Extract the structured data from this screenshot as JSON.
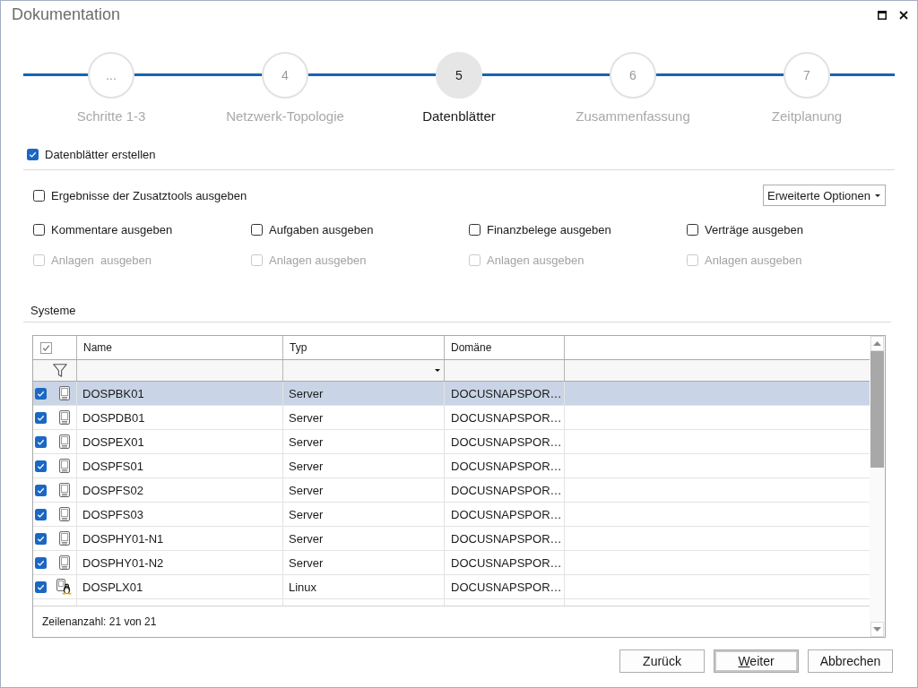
{
  "window": {
    "title": "Dokumentation"
  },
  "steps": [
    {
      "number": "...",
      "label": "Schritte 1-3",
      "selected": false
    },
    {
      "number": "4",
      "label": "Netzwerk-Topologie",
      "selected": false
    },
    {
      "number": "5",
      "label": "Datenblätter",
      "selected": true
    },
    {
      "number": "6",
      "label": "Zusammenfassung",
      "selected": false
    },
    {
      "number": "7",
      "label": "Zeitplanung",
      "selected": false
    }
  ],
  "create_datasheets": {
    "label": "Datenblätter erstellen",
    "checked": true,
    "disabled": false
  },
  "options": {
    "tool_results": {
      "label": "Ergebnisse der Zusatztools ausgeben",
      "checked": false,
      "disabled": false
    },
    "advanced_options": {
      "label": "Erweiterte Optionen"
    },
    "groups": [
      {
        "main": {
          "label": "Kommentare ausgeben",
          "checked": false,
          "disabled": false
        },
        "attachments": {
          "label": "Anlagen  ausgeben",
          "checked": false,
          "disabled": true
        }
      },
      {
        "main": {
          "label": "Aufgaben ausgeben",
          "checked": false,
          "disabled": false
        },
        "attachments": {
          "label": "Anlagen ausgeben",
          "checked": false,
          "disabled": true
        }
      },
      {
        "main": {
          "label": "Finanzbelege ausgeben",
          "checked": false,
          "disabled": false
        },
        "attachments": {
          "label": "Anlagen ausgeben",
          "checked": false,
          "disabled": true
        }
      },
      {
        "main": {
          "label": "Verträge ausgeben",
          "checked": false,
          "disabled": false
        },
        "attachments": {
          "label": "Anlagen ausgeben",
          "checked": false,
          "disabled": true
        }
      }
    ]
  },
  "systems": {
    "title": "Systeme",
    "select_all_checked": true,
    "columns": [
      {
        "label": "Name",
        "kind": "text"
      },
      {
        "label": "Typ",
        "kind": "dropdown"
      },
      {
        "label": "Domäne",
        "kind": "text"
      }
    ],
    "rows": [
      {
        "kind": "server",
        "checked": true,
        "selected": true,
        "cells": [
          "DOSPBK01",
          "Server",
          "DOCUSNAPSPOR…"
        ]
      },
      {
        "kind": "server",
        "checked": true,
        "selected": false,
        "cells": [
          "DOSPDB01",
          "Server",
          "DOCUSNAPSPOR…"
        ]
      },
      {
        "kind": "server",
        "checked": true,
        "selected": false,
        "cells": [
          "DOSPEX01",
          "Server",
          "DOCUSNAPSPOR…"
        ]
      },
      {
        "kind": "server",
        "checked": true,
        "selected": false,
        "cells": [
          "DOSPFS01",
          "Server",
          "DOCUSNAPSPOR…"
        ]
      },
      {
        "kind": "server",
        "checked": true,
        "selected": false,
        "cells": [
          "DOSPFS02",
          "Server",
          "DOCUSNAPSPOR…"
        ]
      },
      {
        "kind": "server",
        "checked": true,
        "selected": false,
        "cells": [
          "DOSPFS03",
          "Server",
          "DOCUSNAPSPOR…"
        ]
      },
      {
        "kind": "server",
        "checked": true,
        "selected": false,
        "cells": [
          "DOSPHY01-N1",
          "Server",
          "DOCUSNAPSPOR…"
        ]
      },
      {
        "kind": "server",
        "checked": true,
        "selected": false,
        "cells": [
          "DOSPHY01-N2",
          "Server",
          "DOCUSNAPSPOR…"
        ]
      },
      {
        "kind": "linux",
        "checked": true,
        "selected": false,
        "cells": [
          "DOSPLX01",
          "Linux",
          "DOCUSNAPSPOR…"
        ]
      }
    ],
    "row_count": "Zeilenanzahl: 21 von 21"
  },
  "buttons": [
    {
      "label": "Zurück",
      "default": false,
      "access_key_underlined": false
    },
    {
      "label": "Weiter",
      "default": true,
      "access_key_underlined": true
    },
    {
      "label": "Abbrechen",
      "default": false,
      "access_key_underlined": false
    }
  ]
}
